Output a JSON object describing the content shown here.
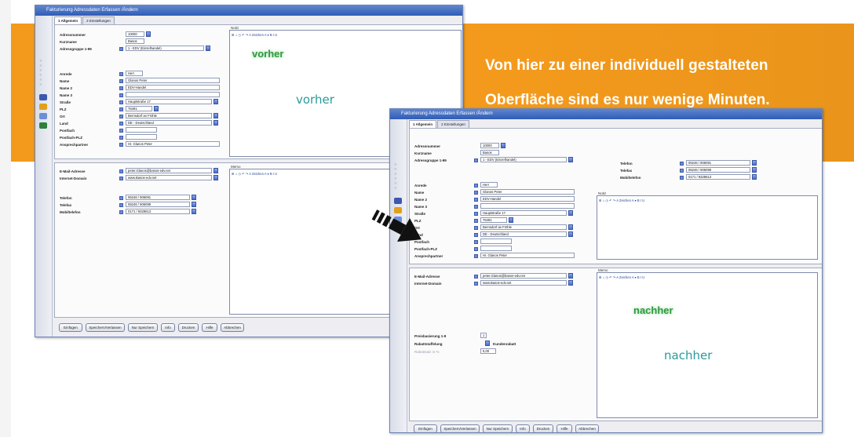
{
  "headline": {
    "line1": "Von hier zu einer individuell gestalteten",
    "line2": "Oberfläche sind es nur wenige Minuten."
  },
  "labels": {
    "vorher_caption": "vorher",
    "nachher_caption": "nachher",
    "vorher_tag": "vorher",
    "nachher_tag": "nachher"
  },
  "colors": {
    "banner": "#f39a1c",
    "caption": "#2a9a9c",
    "tag": "#2e9a3b",
    "titlebar": "#2f5cb6"
  },
  "window": {
    "title": "Fakturierung Adressdaten Erfassen /Ändern",
    "tabs": [
      "1 Allgemein",
      "2 Einstellungen"
    ],
    "fields": {
      "adressnummer_label": "Adressnummer",
      "adressnummer_value": "10000",
      "kurzname_label": "Kurzname",
      "kurzname_value": "Basos",
      "adressgruppe_label": "Adressgruppe 1-99",
      "adressgruppe_value": "1 - EDV (Einzelhandel)",
      "anrede_label": "Anrede",
      "anrede_value": "Herr",
      "name_label": "Name",
      "name_value": "Glanos Peter",
      "name2_label": "Name 2",
      "name2_value": "EDV-Handel",
      "name3_label": "Name 3",
      "name3_value": "",
      "strasse_label": "Straße",
      "strasse_value": "Hauptstraße 17",
      "plz_label": "PLZ",
      "plz_value": "76491",
      "ort_label": "Ort",
      "ort_value": "Bernsdorf an Fröhle",
      "land_label": "Land",
      "land_value": "DE - Deutschland",
      "postfach_label": "Postfach",
      "postfach_plz_label": "Postfach-PLZ",
      "ansprechpartner_label": "Ansprechpartner",
      "ansprechpartner_value": "Hr. Glanos Peter",
      "email_label": "E-Mail-Adresse",
      "email_value": "peter.Glanos@basos-edv.net",
      "internet_label": "Internet-Domain",
      "internet_value": "www.Basos-edv.net",
      "telefon_label": "Telefon",
      "telefon_value": "06246 / 906091",
      "telefax_label": "Telefax",
      "telefax_value": "06246 / 906099",
      "mobil_label": "Mobiltelefon",
      "mobil_value": "0171 / 9328613",
      "notiz_label": "Notiz",
      "memo_label": "Memo",
      "preisgruppe_label": "Preisbasierung 1-9",
      "preisgruppe_value": "1",
      "rabatt_label": "Rabattstaffelung",
      "rabatt_value": "Kundenrabatt",
      "rabatt_pct_label": "Rabattsatz in %",
      "rabatt_pct_value": "5,00"
    },
    "rt_toolbar": "⊞ ⌂ ◷ ↶ ↷  A Zeichen  A ▾  B  I  U",
    "buttons": [
      "Einfügen",
      "Speichern/Verlassen",
      "Nur Speichern",
      "Info",
      "Drucken",
      "Hilfe",
      "Abbrechen"
    ]
  }
}
